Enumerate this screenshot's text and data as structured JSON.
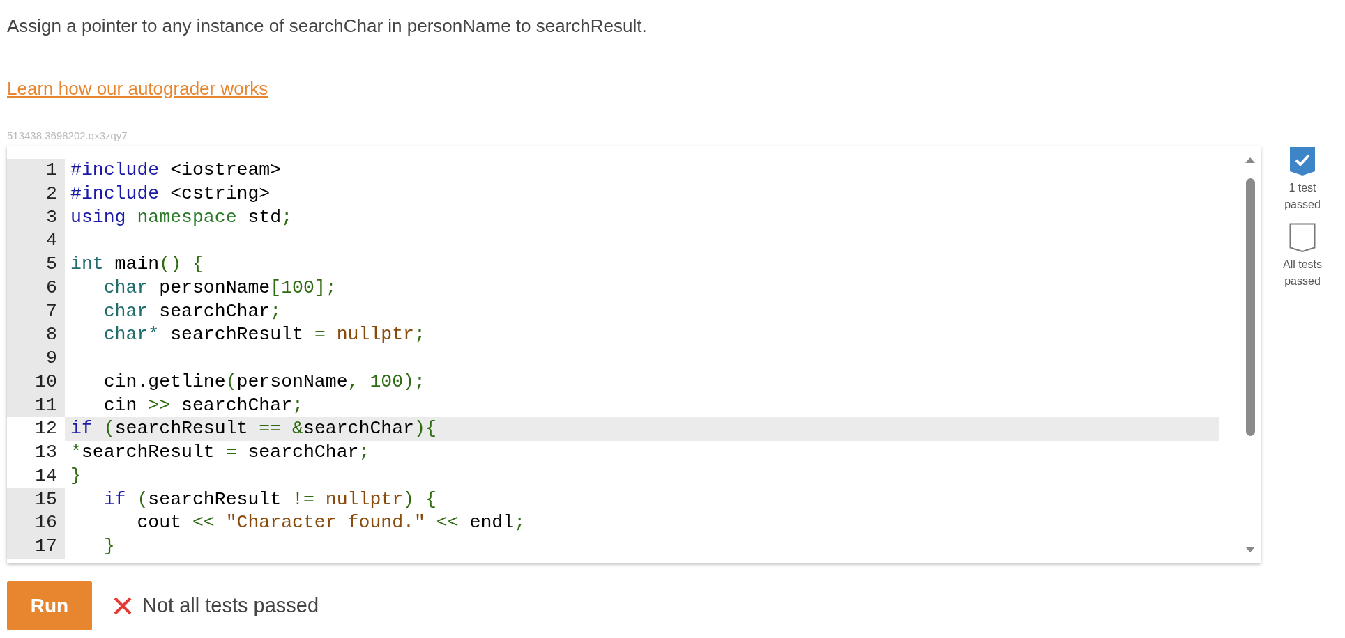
{
  "prompt": {
    "instruction": "Assign a pointer to any instance of searchChar in personName to searchResult.",
    "link": "Learn how our autograder works",
    "code_id": "513438.3698202.qx3zqy7"
  },
  "editor": {
    "lines": [
      {
        "number": "1",
        "active": false,
        "edited": false,
        "tokens": [
          {
            "kind": "keyword",
            "text": "#include"
          },
          {
            "kind": "plain",
            "text": " <iostream>"
          }
        ]
      },
      {
        "number": "2",
        "active": false,
        "edited": false,
        "tokens": [
          {
            "kind": "keyword",
            "text": "#include"
          },
          {
            "kind": "plain",
            "text": " <cstring>"
          }
        ]
      },
      {
        "number": "3",
        "active": false,
        "edited": false,
        "tokens": [
          {
            "kind": "keyword",
            "text": "using"
          },
          {
            "kind": "def",
            "text": " namespace"
          },
          {
            "kind": "plain",
            "text": " std"
          },
          {
            "kind": "punct",
            "text": ";"
          }
        ]
      },
      {
        "number": "4",
        "active": false,
        "edited": false
      },
      {
        "number": "5",
        "active": false,
        "edited": false,
        "tokens": [
          {
            "kind": "type",
            "text": "int"
          },
          {
            "kind": "plain",
            "text": " main"
          },
          {
            "kind": "punct",
            "text": "() {"
          }
        ]
      },
      {
        "number": "6",
        "active": false,
        "edited": false,
        "tokens": [
          {
            "kind": "type",
            "text": "   char"
          },
          {
            "kind": "plain",
            "text": " personName"
          },
          {
            "kind": "punct",
            "text": "["
          },
          {
            "kind": "number",
            "text": "100"
          },
          {
            "kind": "punct",
            "text": "];"
          }
        ]
      },
      {
        "number": "7",
        "active": false,
        "edited": false,
        "tokens": [
          {
            "kind": "type",
            "text": "   char"
          },
          {
            "kind": "plain",
            "text": " searchChar"
          },
          {
            "kind": "punct",
            "text": ";"
          }
        ]
      },
      {
        "number": "8",
        "active": false,
        "edited": false,
        "tokens": [
          {
            "kind": "type",
            "text": "   char*"
          },
          {
            "kind": "plain",
            "text": " searchResult "
          },
          {
            "kind": "punct",
            "text": "="
          },
          {
            "kind": "atom",
            "text": " nullptr"
          },
          {
            "kind": "punct",
            "text": ";"
          }
        ]
      },
      {
        "number": "9",
        "active": false,
        "edited": false
      },
      {
        "number": "10",
        "active": false,
        "edited": false,
        "tokens": [
          {
            "kind": "plain",
            "text": "   cin.getline"
          },
          {
            "kind": "punct",
            "text": "("
          },
          {
            "kind": "plain",
            "text": "personName"
          },
          {
            "kind": "punct",
            "text": ", "
          },
          {
            "kind": "number",
            "text": "100"
          },
          {
            "kind": "punct",
            "text": ");"
          }
        ]
      },
      {
        "number": "11",
        "active": false,
        "edited": false,
        "tokens": [
          {
            "kind": "plain",
            "text": "   cin "
          },
          {
            "kind": "punct",
            "text": ">>"
          },
          {
            "kind": "plain",
            "text": " searchChar"
          },
          {
            "kind": "punct",
            "text": ";"
          }
        ]
      },
      {
        "number": "12",
        "active": true,
        "edited": true,
        "tokens": [
          {
            "kind": "keyword",
            "text": "if"
          },
          {
            "kind": "punct",
            "text": " ("
          },
          {
            "kind": "plain",
            "text": "searchResult "
          },
          {
            "kind": "punct",
            "text": "== &"
          },
          {
            "kind": "plain",
            "text": "searchChar"
          },
          {
            "kind": "punct",
            "text": "){"
          }
        ]
      },
      {
        "number": "13",
        "active": false,
        "edited": true,
        "tokens": [
          {
            "kind": "punct",
            "text": "*"
          },
          {
            "kind": "plain",
            "text": "searchResult "
          },
          {
            "kind": "punct",
            "text": "="
          },
          {
            "kind": "plain",
            "text": " searchChar"
          },
          {
            "kind": "punct",
            "text": ";"
          }
        ]
      },
      {
        "number": "14",
        "active": false,
        "edited": true,
        "tokens": [
          {
            "kind": "punct",
            "text": "}"
          }
        ]
      },
      {
        "number": "15",
        "active": false,
        "edited": false,
        "tokens": [
          {
            "kind": "keyword",
            "text": "   if"
          },
          {
            "kind": "punct",
            "text": " ("
          },
          {
            "kind": "plain",
            "text": "searchResult "
          },
          {
            "kind": "punct",
            "text": "!="
          },
          {
            "kind": "atom",
            "text": " nullptr"
          },
          {
            "kind": "punct",
            "text": ") {"
          }
        ]
      },
      {
        "number": "16",
        "active": false,
        "edited": false,
        "tokens": [
          {
            "kind": "plain",
            "text": "      cout "
          },
          {
            "kind": "punct",
            "text": "<<"
          },
          {
            "kind": "string",
            "text": " \"Character found.\""
          },
          {
            "kind": "punct",
            "text": " <<"
          },
          {
            "kind": "plain",
            "text": " endl"
          },
          {
            "kind": "punct",
            "text": ";"
          }
        ]
      },
      {
        "number": "17",
        "active": false,
        "edited": false,
        "tokens": [
          {
            "kind": "punct",
            "text": "   }"
          }
        ]
      }
    ]
  },
  "checkpoints": [
    {
      "label": "1 test passed",
      "passed": true
    },
    {
      "label": "All tests passed",
      "passed": false
    }
  ],
  "run_button": "Run",
  "result": {
    "passed": false,
    "text": "Not all tests passed"
  }
}
